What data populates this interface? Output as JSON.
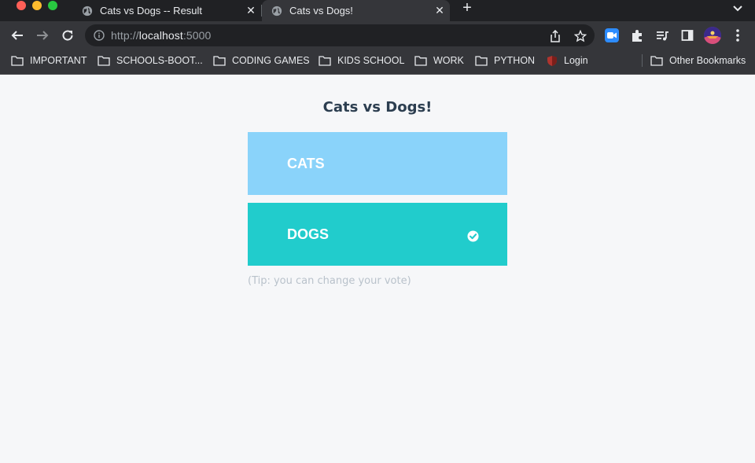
{
  "browser": {
    "tabs": [
      {
        "title": "Cats vs Dogs -- Result",
        "active": false
      },
      {
        "title": "Cats vs Dogs!",
        "active": true
      }
    ],
    "address": {
      "scheme": "http://",
      "host": "localhost",
      "port": ":5000"
    },
    "bookmarks": [
      {
        "label": "IMPORTANT",
        "icon": "folder-icon"
      },
      {
        "label": "SCHOOLS-BOOT...",
        "icon": "folder-icon"
      },
      {
        "label": "CODING GAMES",
        "icon": "folder-icon"
      },
      {
        "label": "KIDS SCHOOL",
        "icon": "folder-icon"
      },
      {
        "label": "WORK",
        "icon": "folder-icon"
      },
      {
        "label": "PYTHON",
        "icon": "folder-icon"
      },
      {
        "label": "Login",
        "icon": "shield-icon"
      }
    ],
    "other_bookmarks": "Other Bookmarks"
  },
  "page": {
    "title": "Cats vs Dogs!",
    "options": [
      {
        "label": "CATS",
        "color": "#8ad3fa",
        "selected": false
      },
      {
        "label": "DOGS",
        "color": "#21cccc",
        "selected": true
      }
    ],
    "tip": "(Tip: you can change your vote)"
  }
}
